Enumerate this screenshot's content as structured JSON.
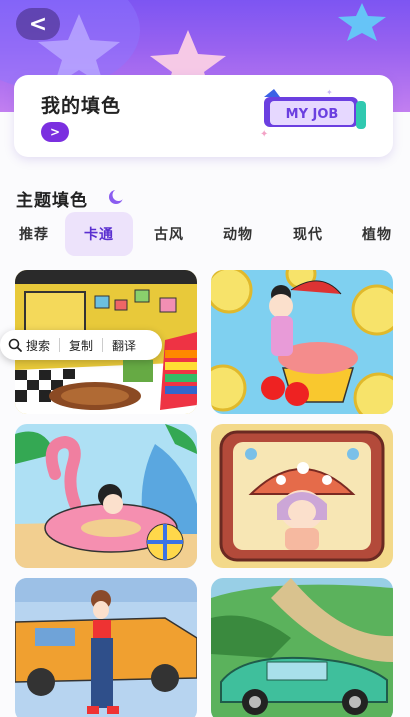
{
  "header": {
    "back_icon": "chevron-left-icon",
    "back_glyph": "<"
  },
  "my_card": {
    "title": "我的填色",
    "go_glyph": ">",
    "badge_text": "MY JOB"
  },
  "section": {
    "title": "主题填色"
  },
  "tabs": [
    {
      "label": "推荐",
      "active": false
    },
    {
      "label": "卡通",
      "active": true
    },
    {
      "label": "古风",
      "active": false
    },
    {
      "label": "动物",
      "active": false
    },
    {
      "label": "现代",
      "active": false
    },
    {
      "label": "植物",
      "active": false
    }
  ],
  "context_menu": {
    "search": "搜索",
    "copy": "复制",
    "translate": "翻译"
  },
  "colors": {
    "accent": "#7b2fe0",
    "tab_active_bg": "#ede3fb",
    "hero_top": "#7d55f2"
  }
}
